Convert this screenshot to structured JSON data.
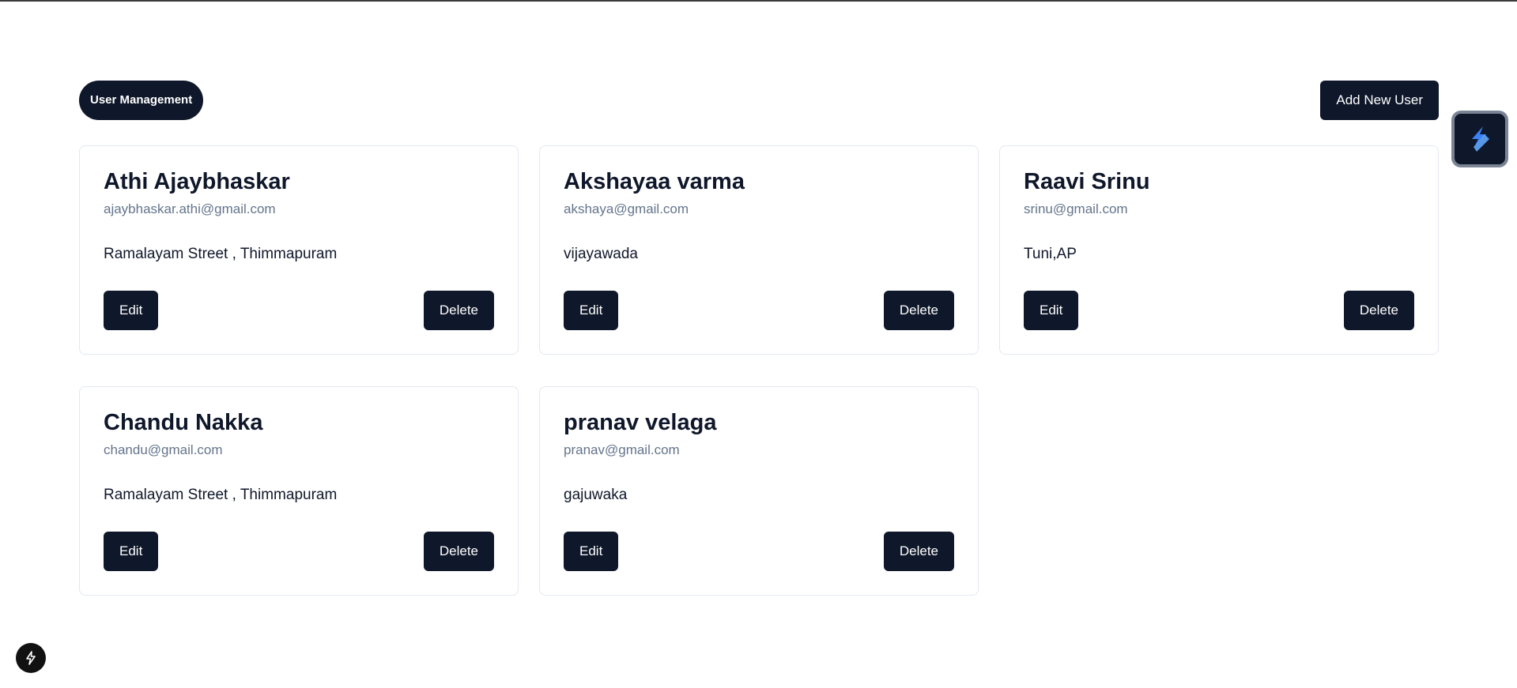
{
  "header": {
    "title": "User Management",
    "add_button_label": "Add New User"
  },
  "actions": {
    "edit_label": "Edit",
    "delete_label": "Delete"
  },
  "users": [
    {
      "name": "Athi Ajaybhaskar",
      "email": "ajaybhaskar.athi@gmail.com",
      "address": "Ramalayam Street , Thimmapuram"
    },
    {
      "name": "Akshayaa varma",
      "email": "akshaya@gmail.com",
      "address": "vijayawada"
    },
    {
      "name": "Raavi Srinu",
      "email": "srinu@gmail.com",
      "address": "Tuni,AP"
    },
    {
      "name": "Chandu Nakka",
      "email": "chandu@gmail.com",
      "address": "Ramalayam Street , Thimmapuram"
    },
    {
      "name": "pranav velaga",
      "email": "pranav@gmail.com",
      "address": "gajuwaka"
    }
  ],
  "icons": {
    "floating_widget": "app-logo-icon",
    "bottom_badge": "lightning-bolt-icon"
  },
  "colors": {
    "primary": "#0f172a",
    "muted_text": "#64748b",
    "card_border": "#e2e8f0"
  }
}
